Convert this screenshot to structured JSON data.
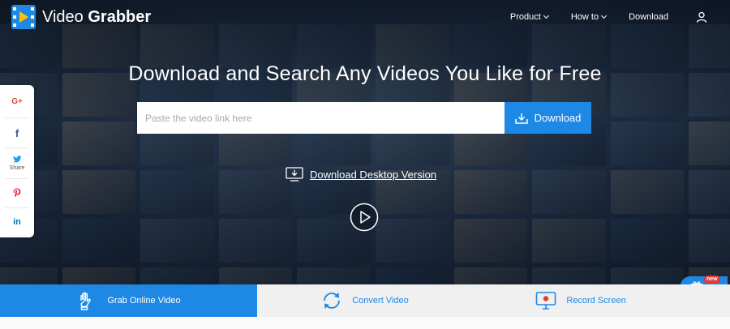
{
  "header": {
    "site_name_regular": "Video ",
    "site_name_bold": "Grabber",
    "nav": [
      {
        "label": "Product",
        "has_dropdown": true
      },
      {
        "label": "How to",
        "has_dropdown": true
      },
      {
        "label": "Download",
        "has_dropdown": false
      }
    ],
    "user_icon": "user-icon"
  },
  "hero": {
    "headline": "Download and Search Any Videos You Like for Free",
    "search": {
      "placeholder": "Paste the video link here",
      "value": ""
    },
    "download_button": "Download",
    "desktop_link": "Download Desktop Version",
    "play_icon": "play-circle-icon"
  },
  "share_bar": {
    "items": [
      {
        "name": "google-plus",
        "symbol": "G+",
        "color": "#dd4b39",
        "label": ""
      },
      {
        "name": "facebook",
        "symbol": "f",
        "color": "#3b5998",
        "label": ""
      },
      {
        "name": "twitter",
        "symbol": "",
        "color": "#1da1f2",
        "label": "Share"
      },
      {
        "name": "pinterest",
        "symbol": "P",
        "color": "#e60023",
        "label": ""
      },
      {
        "name": "linkedin",
        "symbol": "in",
        "color": "#0077b5",
        "label": ""
      }
    ]
  },
  "gift": {
    "badge": "new",
    "icon": "gift-icon"
  },
  "tabs": [
    {
      "label": "Grab Online Video",
      "icon": "hand-icon",
      "active": true
    },
    {
      "label": "Convert Video",
      "icon": "convert-arrows-icon",
      "active": false
    },
    {
      "label": "Record Screen",
      "icon": "monitor-record-icon",
      "active": false
    }
  ],
  "colors": {
    "accent": "#1e88e5",
    "badge": "#e53935",
    "tab_bar": "#f0f0f0"
  }
}
